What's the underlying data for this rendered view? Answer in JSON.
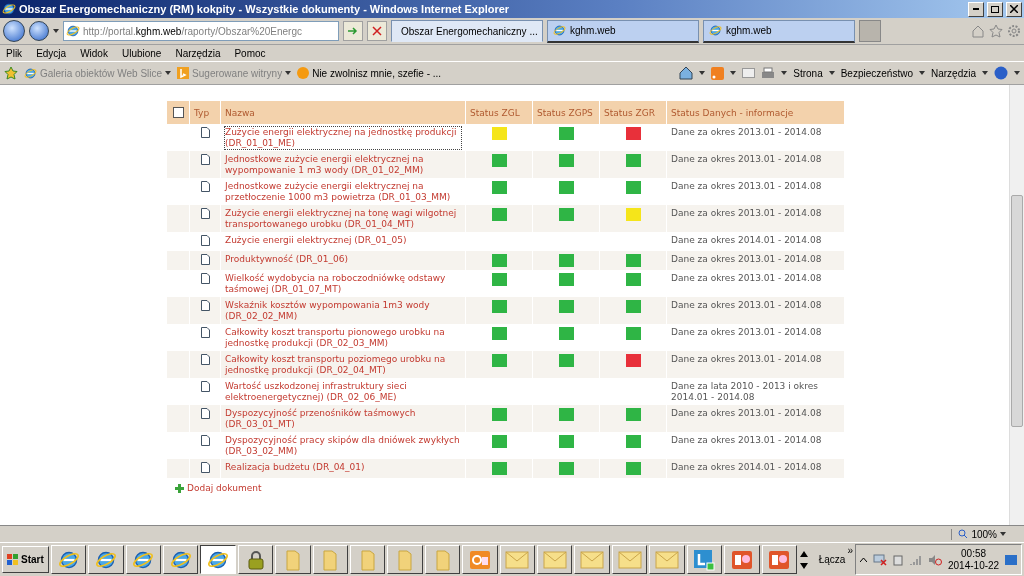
{
  "window": {
    "title": "Obszar Energomechaniczny (RM) kokpity - Wszystkie dokumenty - Windows Internet Explorer"
  },
  "address": {
    "prefix": "http://portal.",
    "domain": "kghm.web",
    "suffix": "/raporty/Obszar%20Energc"
  },
  "tabs": [
    {
      "label": "Obszar Energomechaniczny ...",
      "selected": true
    },
    {
      "label": "kghm.web",
      "selected": false
    },
    {
      "label": "kghm.web",
      "selected": false
    }
  ],
  "menu": [
    "Plik",
    "Edycja",
    "Widok",
    "Ulubione",
    "Narzędzia",
    "Pomoc"
  ],
  "favorites": [
    {
      "label": "Galeria obiektów Web Slice",
      "kind": "slice"
    },
    {
      "label": "Sugerowane witryny",
      "kind": "bing"
    },
    {
      "label": "Nie zwolnisz mnie, szefie - ...",
      "kind": "orb"
    }
  ],
  "command_bar": [
    "Strona",
    "Bezpieczeństwo",
    "Narzędzia"
  ],
  "table": {
    "columns": [
      "Typ",
      "Nazwa",
      "Status ZGL",
      "Status ZGPS",
      "Status ZGR",
      "Status Danych - informacje"
    ],
    "select_all": {
      "checked": false
    },
    "rows": [
      {
        "name": "Zużycie energii elektrycznej na jednostkę produkcji (DR_01_01_ME)",
        "focused": true,
        "statuses": [
          {
            "color": "#f5e51a"
          },
          {
            "color": "#2fb545"
          },
          {
            "color": "#e8303a"
          }
        ],
        "info": "Dane za okres 2013.01 - 2014.08"
      },
      {
        "name": "Jednostkowe zużycie energii elektrycznej na wypompowanie 1 m3 wody (DR_01_02_MM)",
        "focused": false,
        "statuses": [
          {
            "color": "#2fb545"
          },
          {
            "color": "#2fb545"
          },
          {
            "color": "#2fb545"
          }
        ],
        "info": "Dane za okres 2013.01 - 2014.08"
      },
      {
        "name": "Jednostkowe zużycie energii elektrycznej na przetłoczenie 1000 m3 powietrza (DR_01_03_MM)",
        "focused": false,
        "statuses": [
          {
            "color": "#2fb545"
          },
          {
            "color": "#2fb545"
          },
          {
            "color": "#2fb545"
          }
        ],
        "info": "Dane za okres 2013.01 - 2014.08"
      },
      {
        "name": "Zużycie energii elektrycznej na tonę wagi wilgotnej transportowanego urobku (DR_01_04_MT)",
        "focused": false,
        "statuses": [
          {
            "color": "#2fb545"
          },
          {
            "color": "#2fb545"
          },
          {
            "color": "#f5e51a"
          }
        ],
        "info": "Dane za okres 2013.01 - 2014.08"
      },
      {
        "name": "Zużycie energii elektrycznej (DR_01_05)",
        "focused": false,
        "info": "Dane za okres 2014.01 - 2014.08"
      },
      {
        "name": "Produktywność (DR_01_06)",
        "focused": false,
        "statuses": [
          {
            "color": "#2fb545"
          },
          {
            "color": "#2fb545"
          },
          {
            "color": "#2fb545"
          }
        ],
        "info": "Dane za okres 2013.01 - 2014.08"
      },
      {
        "name": "Wielkość wydobycia na roboczodniówkę odstawy taśmowej (DR_01_07_MT)",
        "focused": false,
        "statuses": [
          {
            "color": "#2fb545"
          },
          {
            "color": "#2fb545"
          },
          {
            "color": "#2fb545"
          }
        ],
        "info": "Dane za okres 2013.01 - 2014.08"
      },
      {
        "name": "Wskaźnik kosztów wypompowania 1m3 wody (DR_02_02_MM)",
        "focused": false,
        "statuses": [
          {
            "color": "#2fb545"
          },
          {
            "color": "#2fb545"
          },
          {
            "color": "#2fb545"
          }
        ],
        "info": "Dane za okres 2013.01 - 2014.08"
      },
      {
        "name": "Całkowity koszt transportu pionowego urobku na jednostkę produkcji (DR_02_03_MM)",
        "focused": false,
        "statuses": [
          {
            "color": "#2fb545"
          },
          {
            "color": "#2fb545"
          },
          {
            "color": "#2fb545"
          }
        ],
        "info": "Dane za okres 2013.01 - 2014.08"
      },
      {
        "name": "Całkowity koszt transportu poziomego urobku na jednostkę produkcji (DR_02_04_MT)",
        "focused": false,
        "statuses": [
          {
            "color": "#2fb545"
          },
          {
            "color": "#2fb545"
          },
          {
            "color": "#e8303a"
          }
        ],
        "info": "Dane za okres 2013.01 - 2014.08"
      },
      {
        "name": "Wartość uszkodzonej infrastruktury sieci elektroenergetycznej) (DR_02_06_ME)",
        "focused": false,
        "info": "Dane za lata 2010 - 2013 i okres 2014.01 - 2014.08"
      },
      {
        "name": "Dyspozycyjność przenośników taśmowych (DR_03_01_MT)",
        "focused": false,
        "statuses": [
          {
            "color": "#2fb545"
          },
          {
            "color": "#2fb545"
          },
          {
            "color": "#2fb545"
          }
        ],
        "info": "Dane za okres 2013.01 - 2014.08"
      },
      {
        "name": "Dyspozycyjność pracy skipów dla dniówek zwykłych (DR_03_02_MM)",
        "focused": false,
        "statuses": [
          {
            "color": "#2fb545"
          },
          {
            "color": "#2fb545"
          },
          {
            "color": "#2fb545"
          }
        ],
        "info": "Dane za okres 2013.01 - 2014.08"
      },
      {
        "name": "Realizacja budżetu (DR_04_01)",
        "focused": false,
        "statuses": [
          {
            "color": "#2fb545"
          },
          {
            "color": "#2fb545"
          },
          {
            "color": "#2fb545"
          }
        ],
        "info": "Dane za okres 2014.01 - 2014.08"
      }
    ]
  },
  "add_link": "Dodaj dokument",
  "status_bar": {
    "zoom": "100%"
  },
  "taskbar": {
    "start": "Start",
    "items": [
      {
        "kind": "ie",
        "selected": false
      },
      {
        "kind": "ie",
        "selected": false
      },
      {
        "kind": "ie",
        "selected": false
      },
      {
        "kind": "ie",
        "selected": false
      },
      {
        "kind": "ie",
        "selected": true
      },
      {
        "kind": "lock",
        "selected": false
      },
      {
        "kind": "folder",
        "selected": false
      },
      {
        "kind": "folder",
        "selected": false
      },
      {
        "kind": "folder",
        "selected": false
      },
      {
        "kind": "folder",
        "selected": false
      },
      {
        "kind": "folder",
        "selected": false
      },
      {
        "kind": "outlook",
        "selected": false
      },
      {
        "kind": "mail",
        "selected": false
      },
      {
        "kind": "mail",
        "selected": false
      },
      {
        "kind": "mail",
        "selected": false
      },
      {
        "kind": "mail",
        "selected": false
      },
      {
        "kind": "mail",
        "selected": false
      },
      {
        "kind": "lync",
        "selected": false
      },
      {
        "kind": "ppt",
        "selected": false
      },
      {
        "kind": "ppt",
        "selected": false
      }
    ],
    "links_label": "Łącza",
    "links_more": "»",
    "time": "00:58",
    "date": "2014-10-22"
  }
}
